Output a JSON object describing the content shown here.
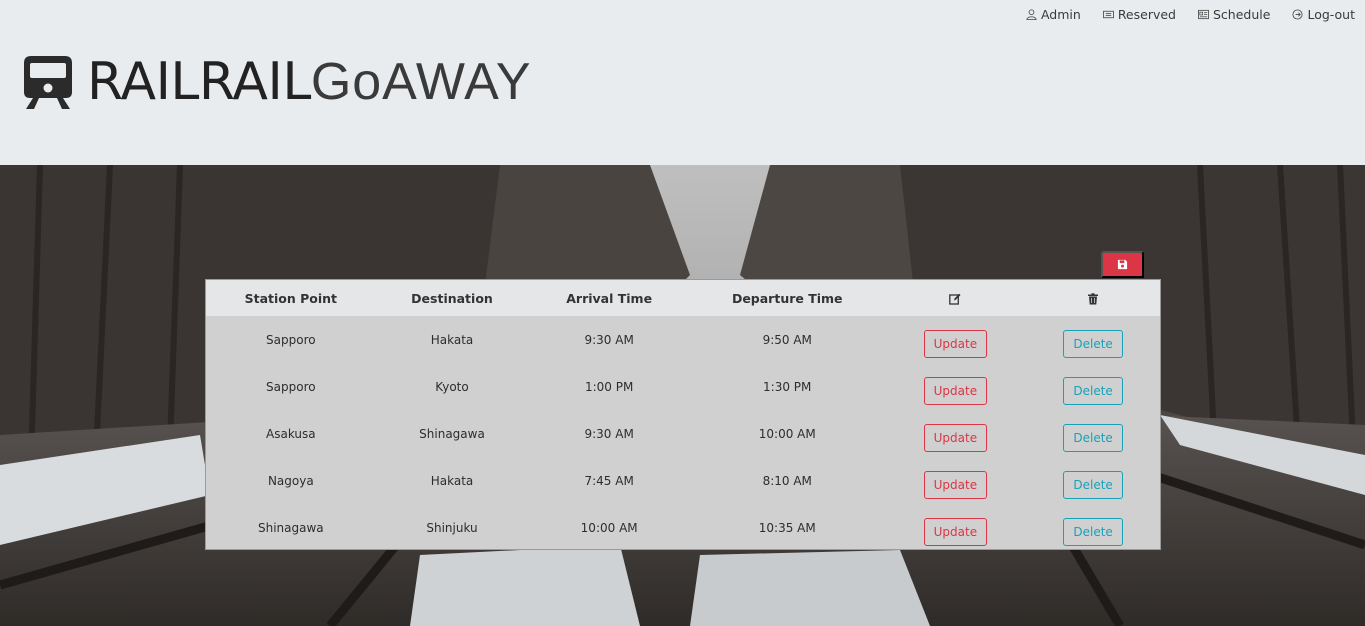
{
  "nav": {
    "items": [
      {
        "label": "Admin",
        "icon": "user-icon"
      },
      {
        "label": "Reserved",
        "icon": "ticket-icon"
      },
      {
        "label": "Schedule",
        "icon": "id-card-icon"
      },
      {
        "label": "Log-out",
        "icon": "logout-icon"
      }
    ]
  },
  "brand": {
    "part1": "RAILRAIL",
    "part2": "GoAWAY",
    "icon": "train-icon"
  },
  "toolbar": {
    "save_icon": "save-icon",
    "save_color": "#dc3545"
  },
  "table": {
    "headers": [
      "Station Point",
      "Destination",
      "Arrival Time",
      "Departure Time"
    ],
    "edit_header_icon": "edit-icon",
    "delete_header_icon": "trash-icon",
    "update_label": "Update",
    "delete_label": "Delete",
    "rows": [
      {
        "station": "Sapporo",
        "destination": "Hakata",
        "arrival": "9:30 AM",
        "departure": "9:50 AM"
      },
      {
        "station": "Sapporo",
        "destination": "Kyoto",
        "arrival": "1:00 PM",
        "departure": "1:30 PM"
      },
      {
        "station": "Asakusa",
        "destination": "Shinagawa",
        "arrival": "9:30 AM",
        "departure": "10:00 AM"
      },
      {
        "station": "Nagoya",
        "destination": "Hakata",
        "arrival": "7:45 AM",
        "departure": "8:10 AM"
      },
      {
        "station": "Shinagawa",
        "destination": "Shinjuku",
        "arrival": "10:00 AM",
        "departure": "10:35 AM"
      }
    ]
  },
  "colors": {
    "danger": "#dc3545",
    "info": "#17a2b8",
    "header_bg": "#e9ecef"
  }
}
